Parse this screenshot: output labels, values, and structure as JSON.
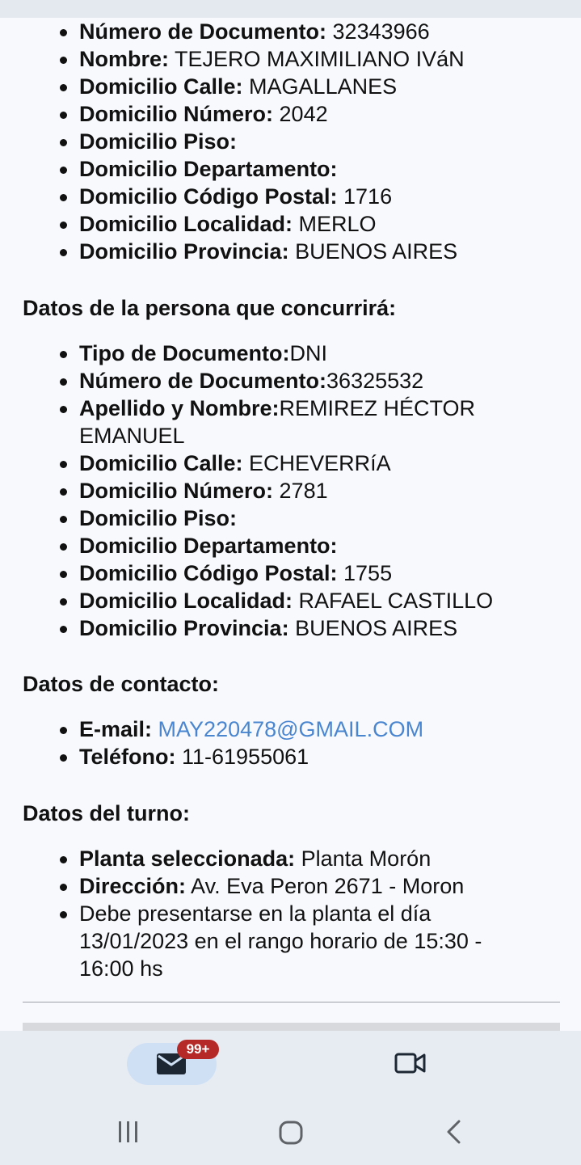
{
  "first_block": [
    {
      "label": "Número de Documento:",
      "value": " 32343966"
    },
    {
      "label": "Nombre:",
      "value": " TEJERO MAXIMILIANO IVáN"
    },
    {
      "label": "Domicilio Calle:",
      "value": " MAGALLANES"
    },
    {
      "label": "Domicilio Número:",
      "value": " 2042"
    },
    {
      "label": "Domicilio Piso:",
      "value": ""
    },
    {
      "label": "Domicilio Departamento:",
      "value": ""
    },
    {
      "label": "Domicilio Código Postal:",
      "value": " 1716"
    },
    {
      "label": "Domicilio Localidad:",
      "value": " MERLO"
    },
    {
      "label": "Domicilio Provincia:",
      "value": " BUENOS AIRES"
    }
  ],
  "person": {
    "title": "Datos de la persona que concurrirá:",
    "fields": [
      {
        "label": "Tipo de Documento:",
        "value": "DNI"
      },
      {
        "label": "Número de Documento:",
        "value": "36325532"
      },
      {
        "label": "Apellido y Nombre:",
        "value": "REMIREZ HÉCTOR EMANUEL"
      },
      {
        "label": "Domicilio Calle:",
        "value": " ECHEVERRíA"
      },
      {
        "label": "Domicilio Número:",
        "value": " 2781"
      },
      {
        "label": "Domicilio Piso:",
        "value": ""
      },
      {
        "label": "Domicilio Departamento:",
        "value": ""
      },
      {
        "label": "Domicilio Código Postal:",
        "value": " 1755"
      },
      {
        "label": "Domicilio Localidad:",
        "value": " RAFAEL CASTILLO"
      },
      {
        "label": "Domicilio Provincia:",
        "value": " BUENOS AIRES"
      }
    ]
  },
  "contact": {
    "title": "Datos de contacto:",
    "email_label": "E-mail:",
    "email_value": "MAY220478@GMAIL.COM",
    "phone_label": "Teléfono:",
    "phone_value": " 11-61955061"
  },
  "turno": {
    "title": "Datos del turno:",
    "planta_label": "Planta seleccionada:",
    "planta_value": " Planta Morón",
    "direccion_label": "Dirección:",
    "direccion_value": " Av. Eva Peron 2671 - Moron",
    "note": "Debe presentarse en la planta el día 13/01/2023 en el rango horario de 15:30 - 16:00 hs"
  },
  "bottom_nav": {
    "mail_badge": "99+",
    "mail_icon": "mail-icon",
    "video_icon": "video-camera-icon"
  },
  "system_nav": {
    "recent_icon": "recent-apps-icon",
    "home_icon": "home-icon",
    "back_icon": "back-icon"
  },
  "colors": {
    "background": "#f8f9fd",
    "link": "#4a86d0",
    "badge": "#b52a28",
    "nav_background": "#e7ecf3",
    "pill": "#cfe0f4"
  }
}
